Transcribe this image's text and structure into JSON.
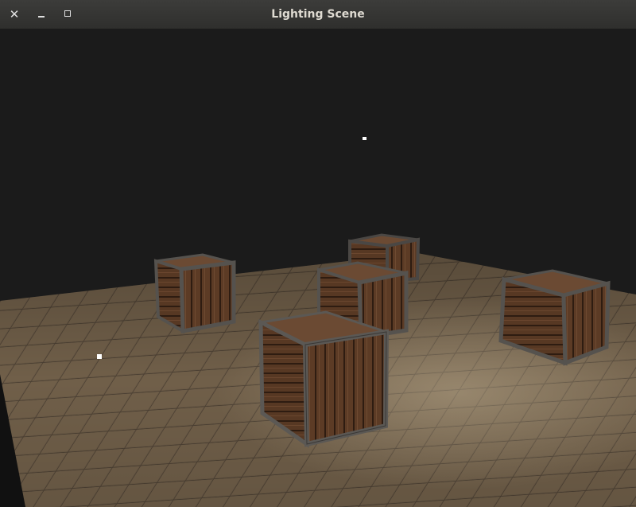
{
  "window": {
    "title": "Lighting Scene",
    "close_icon": "close-icon",
    "minimize_icon": "minimize-icon",
    "maximize_icon": "maximize-icon"
  },
  "scene": {
    "background_color": "#1b1b1b",
    "floor_color": "#6f5e49",
    "crate_color": "#5a3a25",
    "crate_frame_color": "#5b5854",
    "light_color": "#ffffff",
    "crate_count": 5,
    "light_count": 2
  }
}
